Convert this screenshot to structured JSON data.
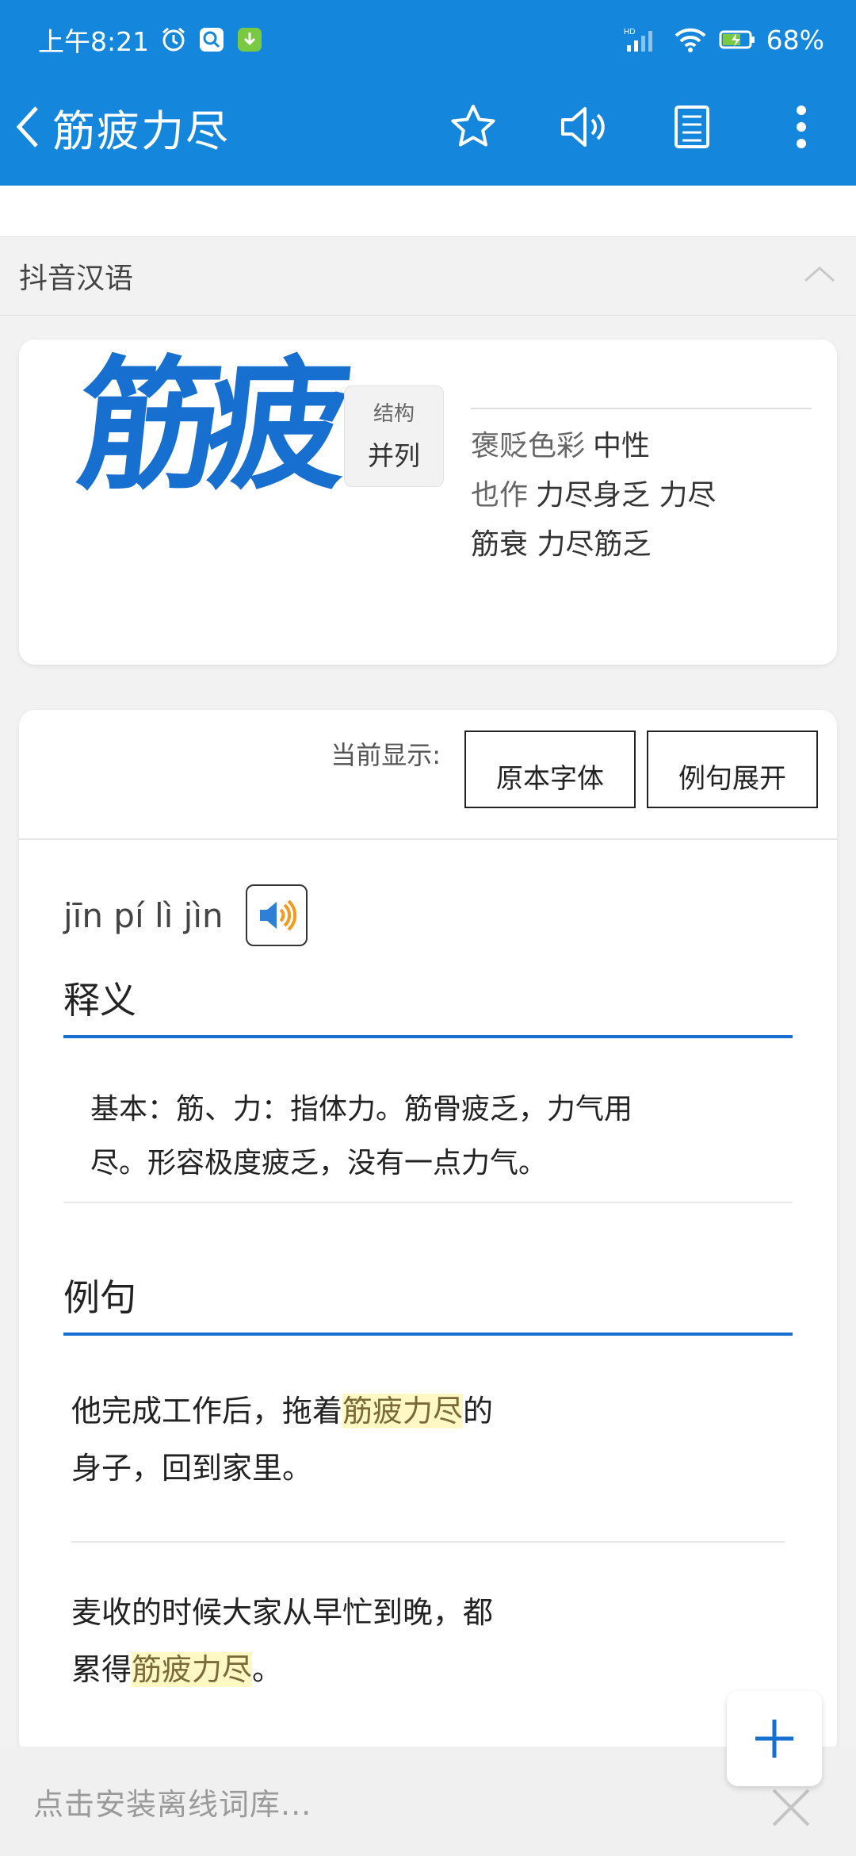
{
  "status": {
    "time": "上午8:21",
    "network": "HD",
    "battery": "68%"
  },
  "header": {
    "title": "筋疲力尽",
    "icons": [
      "back-icon",
      "star-icon",
      "speaker-icon",
      "notes-icon",
      "more-icon"
    ]
  },
  "source": {
    "label": "抖音汉语"
  },
  "summary": {
    "display_word": "筋疲",
    "structure_label": "结构",
    "structure_value": "并列",
    "color_label": "褒贬色彩",
    "color_value": "中性",
    "variant_label": "也作",
    "variant_line1": "力尽身乏 力尽",
    "variant_line2": "筋衰 力尽筋乏"
  },
  "detail": {
    "display_label": "当前显示:",
    "font_button": "原本字体",
    "expand_button": "例句展开",
    "pinyin": "jīn pí lì jìn",
    "meaning_heading": "释义",
    "meaning_line1": "基本：筋、力：指体力。筋骨疲乏，力气用",
    "meaning_line2": "尽。形容极度疲乏，没有一点力气。",
    "examples_heading": "例句",
    "example1_pre": "他完成工作后，拖着",
    "example1_hl": "筋疲力尽",
    "example1_post": "的",
    "example1_line2": "身子，回到家里。",
    "example2_line1": "麦收的时候大家从早忙到晚，都",
    "example2_pre": "累得",
    "example2_hl": "筋疲力尽",
    "example2_post": "。"
  },
  "bottom": {
    "install_text": "点击安装离线词库..."
  },
  "colors": {
    "primary": "#1486db",
    "accent_text": "#1770d0",
    "highlight": "#fff7c4"
  }
}
